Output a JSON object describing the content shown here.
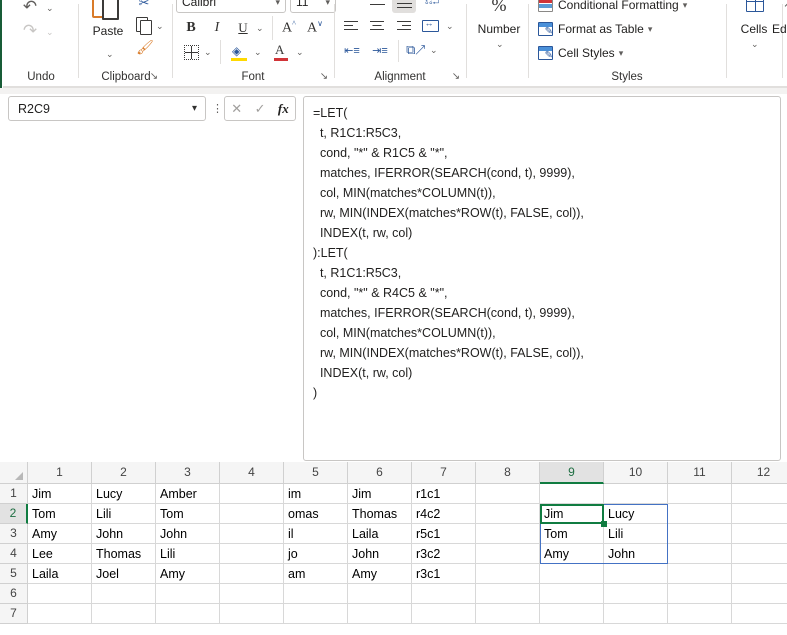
{
  "ribbon": {
    "groups": [
      {
        "label": "Undo"
      },
      {
        "label": "Clipboard"
      },
      {
        "label": "Font"
      },
      {
        "label": "Alignment"
      },
      {
        "label": "Number"
      },
      {
        "label": "Styles"
      },
      {
        "label": "Cells"
      },
      {
        "label": "Editing"
      }
    ],
    "undo": {
      "undo_label": "Undo",
      "redo_label": "Redo"
    },
    "clipboard": {
      "paste_label": "Paste",
      "cut_label": "Cut",
      "copy_label": "Copy",
      "format_painter_label": "Format Painter"
    },
    "font": {
      "font_name": "Calibri",
      "font_size": "11",
      "bold": "B",
      "italic": "I",
      "underline": "U",
      "increase_size": "A",
      "decrease_size": "A",
      "borders_label": "Borders",
      "fill_color_label": "Fill Color",
      "font_color_label": "Font Color"
    },
    "number": {
      "percent_label": "%",
      "group_label": "Number"
    },
    "styles": {
      "conditional_formatting": "Conditional Formatting",
      "format_as_table": "Format as Table",
      "cell_styles": "Cell Styles"
    },
    "cells": {
      "label": "Cells"
    },
    "editing": {
      "label": "Edi"
    }
  },
  "formula_bar": {
    "name_box_value": "R2C9",
    "cancel_label": "Cancel",
    "enter_label": "Enter",
    "insert_function_label": "fx",
    "formula_lines": [
      "=LET(",
      "  t, R1C1:R5C3,",
      "  cond, \"*\" & R1C5 & \"*\",",
      "  matches, IFERROR(SEARCH(cond, t), 9999),",
      "  col, MIN(matches*COLUMN(t)),",
      "  rw, MIN(INDEX(matches*ROW(t), FALSE, col)),",
      "  INDEX(t, rw, col)",
      "):LET(",
      "  t, R1C1:R5C3,",
      "  cond, \"*\" & R4C5 & \"*\",",
      "  matches, IFERROR(SEARCH(cond, t), 9999),",
      "  col, MIN(matches*COLUMN(t)),",
      "  rw, MIN(INDEX(matches*ROW(t), FALSE, col)),",
      "  INDEX(t, rw, col)",
      ")"
    ]
  },
  "grid": {
    "column_headers": [
      "1",
      "2",
      "3",
      "4",
      "5",
      "6",
      "7",
      "8",
      "9",
      "10",
      "11",
      "12"
    ],
    "row_headers": [
      "1",
      "2",
      "3",
      "4",
      "5",
      "6",
      "7"
    ],
    "selected_column": "9",
    "selected_row": "2",
    "active_cell": "R2C9",
    "spill_range": "R2C9:R4C10",
    "rows": [
      [
        "Jim",
        "Lucy",
        "Amber",
        "",
        "im",
        "Jim",
        "r1c1",
        "",
        "",
        "",
        "",
        ""
      ],
      [
        "Tom",
        "Lili",
        "Tom",
        "",
        "omas",
        "Thomas",
        "r4c2",
        "",
        "Jim",
        "Lucy",
        "",
        ""
      ],
      [
        "Amy",
        "John",
        "John",
        "",
        "il",
        "Laila",
        "r5c1",
        "",
        "Tom",
        "Lili",
        "",
        ""
      ],
      [
        "Lee",
        "Thomas",
        "Lili",
        "",
        "jo",
        "John",
        "r3c2",
        "",
        "Amy",
        "John",
        "",
        ""
      ],
      [
        "Laila",
        "Joel",
        "Amy",
        "",
        "am",
        "Amy",
        "r3c1",
        "",
        "",
        "",
        "",
        ""
      ],
      [
        "",
        "",
        "",
        "",
        "",
        "",
        "",
        "",
        "",
        "",
        "",
        ""
      ],
      [
        "",
        "",
        "",
        "",
        "",
        "",
        "",
        "",
        "",
        "",
        "",
        ""
      ]
    ]
  },
  "colors": {
    "accent_green": "#107c41",
    "spill_blue": "#4472c4",
    "header_bg": "#f5f5f5",
    "gridline": "#d8d8d8"
  }
}
